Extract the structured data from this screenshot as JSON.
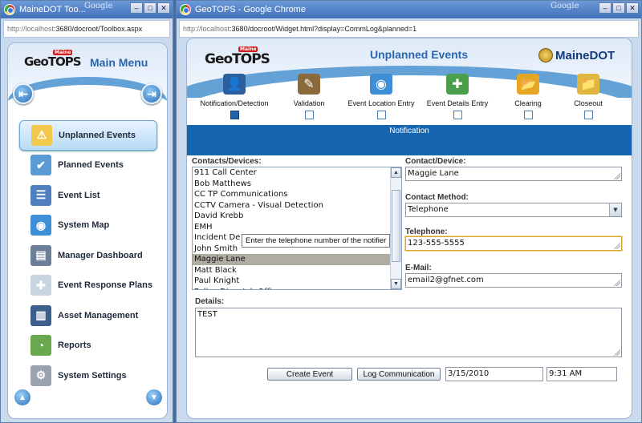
{
  "left_window": {
    "title": "MaineDOT Too...",
    "google": "Google",
    "url_host": "http://localhost",
    "url_path": ":3680/docroot/Toolbox.aspx",
    "win_buttons": [
      "–",
      "□",
      "✕"
    ]
  },
  "right_window": {
    "title": "GeoTOPS - Google Chrome",
    "google": "Google",
    "url_host": "http://localhost",
    "url_path": ":3680/docroot/Widget.html?display=CommLog&planned=1",
    "win_buttons": [
      "–",
      "□",
      "✕"
    ]
  },
  "toolbox": {
    "logo_geo": "Geo",
    "logo_tops": "TOPS",
    "logo_badge": "Maine",
    "title": "Main Menu",
    "back_glyph": "⇤",
    "forward_glyph": "⇥",
    "menu": [
      {
        "label": "Unplanned Events",
        "icon": "warning-icon",
        "glyph": "⚠",
        "color": "#f2c94c",
        "active": true
      },
      {
        "label": "Planned Events",
        "icon": "checklist-icon",
        "glyph": "✔",
        "color": "#5b9bd5",
        "active": false
      },
      {
        "label": "Event List",
        "icon": "list-icon",
        "glyph": "☰",
        "color": "#4f7fbf",
        "active": false
      },
      {
        "label": "System Map",
        "icon": "globe-icon",
        "glyph": "◉",
        "color": "#3f8fd8",
        "active": false
      },
      {
        "label": "Manager Dashboard",
        "icon": "dashboard-icon",
        "glyph": "▤",
        "color": "#6b7f99",
        "active": false
      },
      {
        "label": "Event Response Plans",
        "icon": "ambulance-icon",
        "glyph": "✚",
        "color": "#c9d4e2",
        "active": false
      },
      {
        "label": "Asset Management",
        "icon": "server-icon",
        "glyph": "▥",
        "color": "#3d5f8c",
        "active": false
      },
      {
        "label": "Reports",
        "icon": "report-chart-icon",
        "glyph": "◔",
        "color": "#6aa84f",
        "active": false
      },
      {
        "label": "System Settings",
        "icon": "gears-icon",
        "glyph": "⚙",
        "color": "#9aa3ad",
        "active": false
      }
    ],
    "scroll_up_glyph": "▲",
    "scroll_down_glyph": "▼"
  },
  "widget": {
    "logo_geo": "Geo",
    "logo_tops": "TOPS",
    "logo_badge": "Maine",
    "title": "Unplanned Events",
    "brand": "MaineDOT",
    "steps": [
      {
        "label": "Notification/Detection",
        "icon": "user-info-icon",
        "glyph": "👤",
        "active": true
      },
      {
        "label": "Validation",
        "icon": "validation-clipboard-icon",
        "glyph": "✎",
        "active": false
      },
      {
        "label": "Event Location Entry",
        "icon": "globe-location-icon",
        "glyph": "◉",
        "active": false
      },
      {
        "label": "Event Details Entry",
        "icon": "document-add-icon",
        "glyph": "✚",
        "active": false
      },
      {
        "label": "Clearing",
        "icon": "folder-open-icon",
        "glyph": "📂",
        "active": false
      },
      {
        "label": "Closeout",
        "icon": "folder-closed-icon",
        "glyph": "📁",
        "active": false
      }
    ],
    "band_text": "Notification",
    "contacts_label": "Contacts/Devices:",
    "contacts": [
      "911 Call Center",
      "Bob Matthews",
      "CC TP Communications",
      "CCTV Camera - Visual Detection",
      "David Krebb",
      "EMH",
      "Incident De",
      "John Smith",
      "Maggie Lane",
      "Matt Black",
      "Paul Knight",
      "Police Dispatch Office"
    ],
    "selected_contact": "Maggie Lane",
    "tooltip": "Enter the telephone number of the notifier",
    "contact_device_label": "Contact/Device:",
    "contact_device_value": "Maggie Lane",
    "contact_method_label": "Contact Method:",
    "contact_method_value": "Telephone",
    "telephone_label": "Telephone:",
    "telephone_value": "123-555-5555",
    "email_label": "E-Mail:",
    "email_value": "email2@gfnet.com",
    "details_label": "Details:",
    "details_value": "TEST",
    "create_button": "Create Event",
    "log_button": "Log Communication",
    "date_value": "3/15/2010",
    "time_value": "9:31 AM"
  }
}
